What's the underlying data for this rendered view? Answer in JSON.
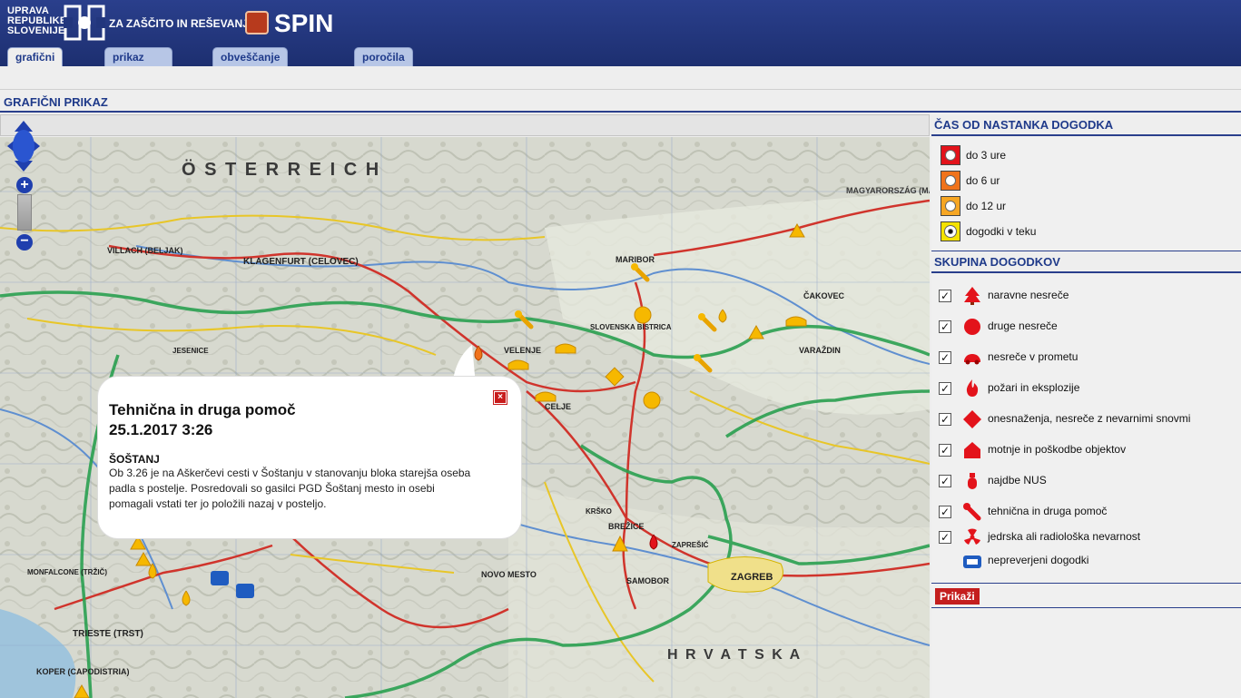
{
  "header": {
    "org_lines": [
      "UPRAVA",
      "REPUBLIKE",
      "SLOVENIJE"
    ],
    "org_sub": "ZA ZAŠČITO IN REŠEVANJE",
    "app_name": "SPIN",
    "colors": {
      "header_bg": "#22367d",
      "accent": "#1f3a8a"
    }
  },
  "tabs": [
    {
      "label": "grafični prikaz",
      "active": true
    },
    {
      "label": "prikaz dogodkov",
      "active": false
    },
    {
      "label": "obveščanje o dogodkih",
      "active": false
    },
    {
      "label": "poročila",
      "active": false
    }
  ],
  "page": {
    "section_title": "GRAFIČNI PRIKAZ"
  },
  "map": {
    "controls": {
      "pan": "pan-arrows-icon",
      "zoom_in": "+",
      "zoom_out": "−"
    },
    "labels": {
      "osterreich": "Ö S T E R R E I C H",
      "klagenfurt": "KLAGENFURT (CELOVEC)",
      "villach": "VILLACH (BELJAK)",
      "maribor": "MARIBOR",
      "celje": "CELJE",
      "velenje": "VELENJE",
      "slovenska_bistrica": "SLOVENSKA BISTRICA",
      "cakovec": "ČAKOVEC",
      "varazdin": "VARAŽDIN",
      "zagreb": "ZAGREB",
      "brezice": "BREŽICE",
      "samobor": "SAMOBOR",
      "novo_mesto": "NOVO MESTO",
      "trieste": "TRIESTE (TRST)",
      "koper": "KOPER (CAPODISTRIA)",
      "hrvatska": "H R V A T S K A",
      "magyarorszag": "MAGYARORSZÁG (MADŽARSKA)",
      "jesenice": "JESENICE",
      "monfalcone": "MONFALCONE (TRŽIČ)",
      "zapresic": "ZAPREŠIĆ",
      "krsko": "KRŠKO"
    },
    "popup": {
      "title": "Tehnična in druga pomoč",
      "datetime": "25.1.2017 3:26",
      "place": "ŠOŠTANJ",
      "text": "Ob 3.26 je na Aškerčevi cesti v Šoštanju v stanovanju bloka starejša oseba padla s postelje. Posredovali so gasilci PGD Šoštanj mesto in osebi pomagali vstati ter jo položili nazaj v posteljo.",
      "close_icon": "close-icon"
    }
  },
  "panel": {
    "time_title": "ČAS OD NASTANKA DOGODKA",
    "time_legend": [
      {
        "label": "do 3 ure",
        "color": "#e3131b"
      },
      {
        "label": "do 6 ur",
        "color": "#f0731c"
      },
      {
        "label": "do 12 ur",
        "color": "#f6a623"
      },
      {
        "label": "dogodki v teku",
        "color": "#f4e200"
      }
    ],
    "group_title": "SKUPINA DOGODKOV",
    "groups": [
      {
        "label": "naravne nesreče",
        "icon": "tree-icon",
        "checked": true
      },
      {
        "label": "druge nesreče",
        "icon": "circle-icon",
        "checked": true
      },
      {
        "label": "nesreče v prometu",
        "icon": "car-icon",
        "checked": true
      },
      {
        "label": "požari in eksplozije",
        "icon": "fire-icon",
        "checked": true
      },
      {
        "label": "onesnaženja, nesreče z nevarnimi snovmi",
        "icon": "diamond-icon",
        "checked": true
      },
      {
        "label": "motnje in poškodbe objektov",
        "icon": "house-icon",
        "checked": true
      },
      {
        "label": "najdbe NUS",
        "icon": "grenade-icon",
        "checked": true
      },
      {
        "label": "tehnična in druga pomoč",
        "icon": "wrench-icon",
        "checked": true
      },
      {
        "label": "jedrska ali radiološka nevarnost",
        "icon": "radiation-icon",
        "checked": true
      },
      {
        "label": "nepreverjeni dogodki",
        "icon": "phone-icon",
        "checked": false
      }
    ],
    "show_button": "Prikaži"
  }
}
